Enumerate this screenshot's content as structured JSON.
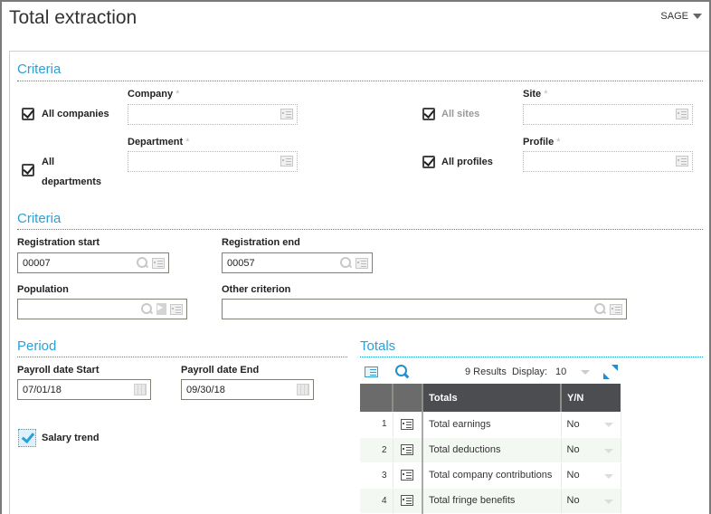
{
  "header": {
    "title": "Total extraction",
    "user_menu": "SAGE"
  },
  "criteria1": {
    "title": "Criteria",
    "all_companies": {
      "label": "All companies",
      "checked": true
    },
    "company": {
      "label": "Company",
      "value": ""
    },
    "all_sites": {
      "label": "All sites",
      "checked": true
    },
    "site": {
      "label": "Site",
      "value": ""
    },
    "all_departments": {
      "label_line1": "All",
      "label_line2": "departments",
      "checked": true
    },
    "department": {
      "label": "Department",
      "value": ""
    },
    "all_profiles": {
      "label": "All profiles",
      "checked": true
    },
    "profile": {
      "label": "Profile",
      "value": ""
    },
    "required_mark": "*"
  },
  "criteria2": {
    "title": "Criteria",
    "registration_start": {
      "label": "Registration start",
      "value": "00007"
    },
    "registration_end": {
      "label": "Registration end",
      "value": "00057"
    },
    "population": {
      "label": "Population",
      "value": ""
    },
    "other_criterion": {
      "label": "Other criterion",
      "value": ""
    }
  },
  "period": {
    "title": "Period",
    "payroll_start": {
      "label": "Payroll date Start",
      "value": "07/01/18"
    },
    "payroll_end": {
      "label": "Payroll date End",
      "value": "09/30/18"
    },
    "salary_trend": {
      "label": "Salary trend",
      "checked": true
    }
  },
  "totals": {
    "title": "Totals",
    "results_text": "9 Results",
    "display_label": "Display:",
    "display_value": "10",
    "columns": [
      "",
      "",
      "Totals",
      "Y/N"
    ],
    "rows": [
      {
        "num": "1",
        "name": "Total earnings",
        "yn": "No"
      },
      {
        "num": "2",
        "name": "Total deductions",
        "yn": "No"
      },
      {
        "num": "3",
        "name": "Total company contributions",
        "yn": "No"
      },
      {
        "num": "4",
        "name": "Total fringe benefits",
        "yn": "No"
      }
    ]
  },
  "colors": {
    "accent": "#2aa0d8",
    "table_header": "#4c4d50"
  }
}
